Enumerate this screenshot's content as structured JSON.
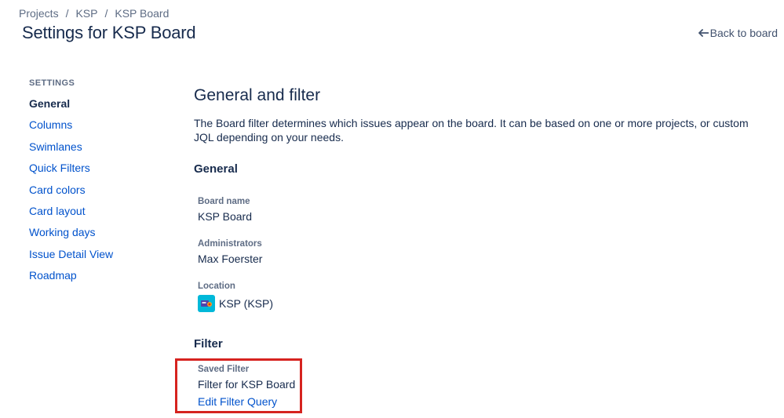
{
  "breadcrumb": {
    "items": [
      "Projects",
      "KSP",
      "KSP Board"
    ],
    "separator": "/"
  },
  "header": {
    "title": "Settings for KSP Board",
    "back_label": "Back to board"
  },
  "sidebar": {
    "heading": "SETTINGS",
    "items": [
      {
        "label": "General",
        "active": true
      },
      {
        "label": "Columns"
      },
      {
        "label": "Swimlanes"
      },
      {
        "label": "Quick Filters"
      },
      {
        "label": "Card colors"
      },
      {
        "label": "Card layout"
      },
      {
        "label": "Working days"
      },
      {
        "label": "Issue Detail View"
      },
      {
        "label": "Roadmap"
      }
    ]
  },
  "main": {
    "title": "General and filter",
    "description": "The Board filter determines which issues appear on the board. It can be based on one or more projects, or custom JQL depending on your needs.",
    "general": {
      "heading": "General",
      "board_name_label": "Board name",
      "board_name_value": "KSP Board",
      "administrators_label": "Administrators",
      "administrators_value": "Max Foerster",
      "location_label": "Location",
      "location_value": "KSP (KSP)"
    },
    "filter": {
      "heading": "Filter",
      "saved_filter_label": "Saved Filter",
      "saved_filter_value": "Filter for KSP Board",
      "edit_link": "Edit Filter Query"
    }
  },
  "colors": {
    "link": "#0052cc",
    "text": "#172b4d",
    "subtle": "#5e6c84",
    "highlight": "#d6231f",
    "avatar": "#00b8d9"
  },
  "icons": [
    "back-arrow-icon",
    "project-avatar-icon"
  ]
}
